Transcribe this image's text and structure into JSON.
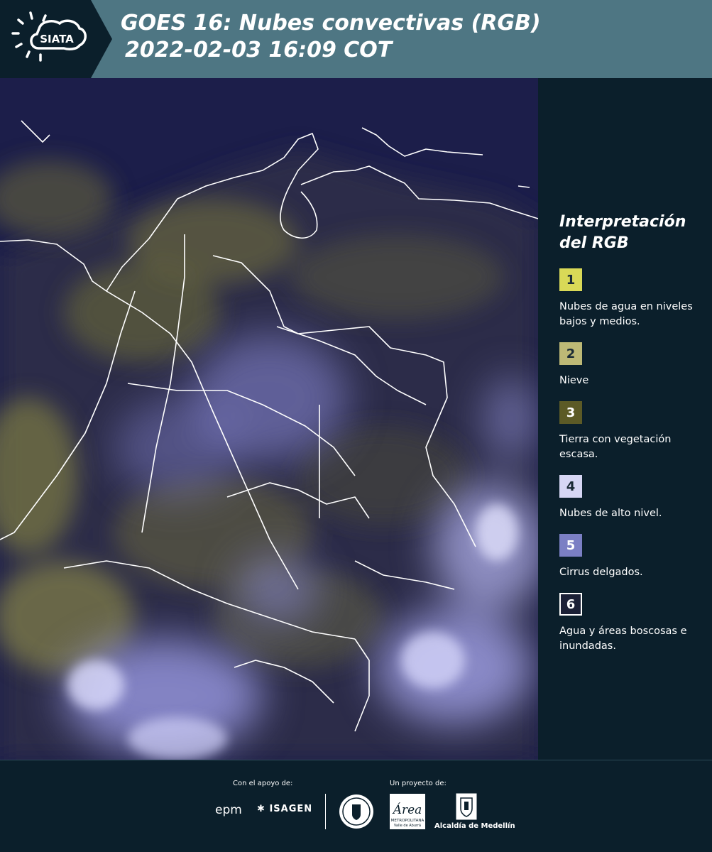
{
  "header": {
    "logo_text": "SIATA",
    "title_line1": "GOES 16: Nubes convectivas (RGB)",
    "title_line2": "2022-02-03 16:09 COT",
    "background_color": "#4e7683",
    "logo_tab_color": "#0b1f2b"
  },
  "map": {
    "icon": "satellite-map",
    "ocean_color": "#1c1e4a",
    "border_color": "#ffffff"
  },
  "legend": {
    "title_line1": "Interpretación",
    "title_line2": "del RGB",
    "items": [
      {
        "number": "1",
        "color": "#d9d957",
        "text": "Nubes de agua en niveles bajos y medios."
      },
      {
        "number": "2",
        "color": "#bdb976",
        "text": "Nieve"
      },
      {
        "number": "3",
        "color": "#5c5a26",
        "text": "Tierra con vegetación escasa."
      },
      {
        "number": "4",
        "color": "#d6d6f4",
        "text": "Nubes de alto nivel."
      },
      {
        "number": "5",
        "color": "#7b7fc4",
        "text": "Cirrus delgados."
      },
      {
        "number": "6",
        "color": "#1b2036",
        "text": "Agua y áreas boscosas e inundadas."
      }
    ]
  },
  "footer": {
    "support_label": "Con el apoyo de:",
    "project_label": "Un proyecto de:",
    "sponsors": [
      "epm",
      "ISAGEN"
    ],
    "partners": [
      "Área Metropolitana Valle de Aburrá",
      "Alcaldía de Medellín"
    ],
    "epm_text": "epm",
    "isagen_text": "ISAGEN",
    "area_text": "Área",
    "area_subtext": "METROPOLITANA",
    "area_subtext2": "Valle de Aburrá",
    "alcaldia_text": "Alcaldía de Medellín"
  }
}
